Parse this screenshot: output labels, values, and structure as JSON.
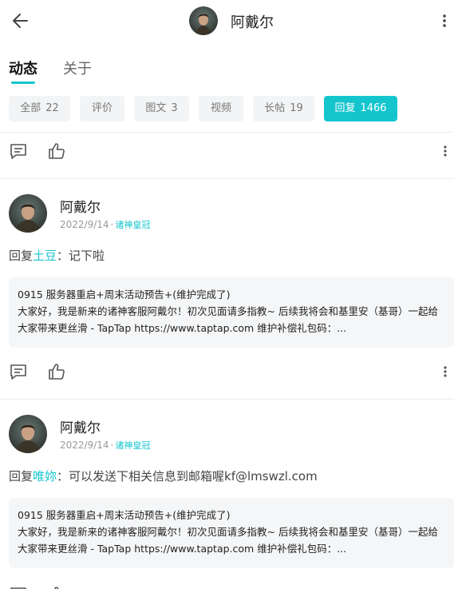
{
  "header": {
    "back_icon": "arrow-left-icon",
    "name": "阿戴尔",
    "more_icon": "more-vertical-icon"
  },
  "tabs": [
    {
      "label": "动态",
      "active": true
    },
    {
      "label": "关于",
      "active": false
    }
  ],
  "filters": [
    {
      "label": "全部",
      "count": "22",
      "active": false
    },
    {
      "label": "评价",
      "count": "",
      "active": false
    },
    {
      "label": "图文",
      "count": "3",
      "active": false
    },
    {
      "label": "视频",
      "count": "",
      "active": false
    },
    {
      "label": "长帖",
      "count": "19",
      "active": false
    },
    {
      "label": "回复",
      "count": "1466",
      "active": true
    }
  ],
  "colors": {
    "accent": "#15c5ce",
    "chip_bg": "#f3f4f5",
    "quote_bg": "#f5f6f7"
  },
  "posts": [
    {
      "author": "阿戴尔",
      "date": "2022/9/14",
      "separator": "·",
      "badge": "诸神皇冠",
      "reply_prefix": "回复",
      "reply_to": "土豆",
      "reply_text": "：记下啦",
      "quote_title": "0915 服务器重启+周末活动预告+(维护完成了)",
      "quote_body": "大家好，我是新来的诸神客服阿戴尔！初次见面请多指教~ 后续我将会和基里安（基哥）一起给大家带来更丝滑 - TapTap https://www.taptap.com 维护补偿礼包码：..."
    },
    {
      "author": "阿戴尔",
      "date": "2022/9/14",
      "separator": "·",
      "badge": "诸神皇冠",
      "reply_prefix": "回复",
      "reply_to": "唯妳",
      "reply_text": "：可以发送下相关信息到邮箱喔kf@lmswzl.com",
      "quote_title": "0915 服务器重启+周末活动预告+(维护完成了)",
      "quote_body": "大家好，我是新来的诸神客服阿戴尔！初次见面请多指教~ 后续我将会和基里安（基哥）一起给大家带来更丝滑 - TapTap https://www.taptap.com 维护补偿礼包码：..."
    }
  ],
  "action_icons": {
    "comment": "comment-icon",
    "like": "thumbs-up-icon",
    "more": "more-vertical-icon"
  }
}
